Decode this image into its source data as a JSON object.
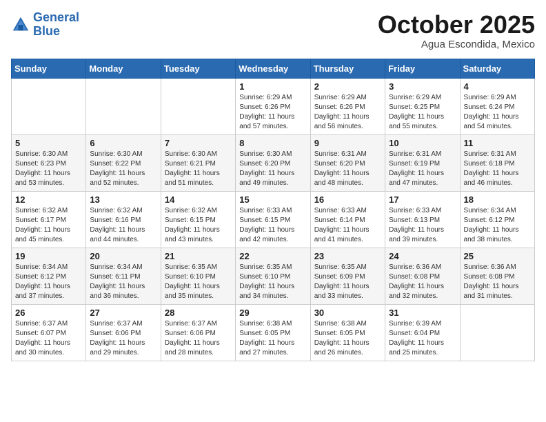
{
  "header": {
    "logo_line1": "General",
    "logo_line2": "Blue",
    "month": "October 2025",
    "location": "Agua Escondida, Mexico"
  },
  "weekdays": [
    "Sunday",
    "Monday",
    "Tuesday",
    "Wednesday",
    "Thursday",
    "Friday",
    "Saturday"
  ],
  "weeks": [
    [
      {
        "day": "",
        "info": ""
      },
      {
        "day": "",
        "info": ""
      },
      {
        "day": "",
        "info": ""
      },
      {
        "day": "1",
        "info": "Sunrise: 6:29 AM\nSunset: 6:26 PM\nDaylight: 11 hours and 57 minutes."
      },
      {
        "day": "2",
        "info": "Sunrise: 6:29 AM\nSunset: 6:26 PM\nDaylight: 11 hours and 56 minutes."
      },
      {
        "day": "3",
        "info": "Sunrise: 6:29 AM\nSunset: 6:25 PM\nDaylight: 11 hours and 55 minutes."
      },
      {
        "day": "4",
        "info": "Sunrise: 6:29 AM\nSunset: 6:24 PM\nDaylight: 11 hours and 54 minutes."
      }
    ],
    [
      {
        "day": "5",
        "info": "Sunrise: 6:30 AM\nSunset: 6:23 PM\nDaylight: 11 hours and 53 minutes."
      },
      {
        "day": "6",
        "info": "Sunrise: 6:30 AM\nSunset: 6:22 PM\nDaylight: 11 hours and 52 minutes."
      },
      {
        "day": "7",
        "info": "Sunrise: 6:30 AM\nSunset: 6:21 PM\nDaylight: 11 hours and 51 minutes."
      },
      {
        "day": "8",
        "info": "Sunrise: 6:30 AM\nSunset: 6:20 PM\nDaylight: 11 hours and 49 minutes."
      },
      {
        "day": "9",
        "info": "Sunrise: 6:31 AM\nSunset: 6:20 PM\nDaylight: 11 hours and 48 minutes."
      },
      {
        "day": "10",
        "info": "Sunrise: 6:31 AM\nSunset: 6:19 PM\nDaylight: 11 hours and 47 minutes."
      },
      {
        "day": "11",
        "info": "Sunrise: 6:31 AM\nSunset: 6:18 PM\nDaylight: 11 hours and 46 minutes."
      }
    ],
    [
      {
        "day": "12",
        "info": "Sunrise: 6:32 AM\nSunset: 6:17 PM\nDaylight: 11 hours and 45 minutes."
      },
      {
        "day": "13",
        "info": "Sunrise: 6:32 AM\nSunset: 6:16 PM\nDaylight: 11 hours and 44 minutes."
      },
      {
        "day": "14",
        "info": "Sunrise: 6:32 AM\nSunset: 6:15 PM\nDaylight: 11 hours and 43 minutes."
      },
      {
        "day": "15",
        "info": "Sunrise: 6:33 AM\nSunset: 6:15 PM\nDaylight: 11 hours and 42 minutes."
      },
      {
        "day": "16",
        "info": "Sunrise: 6:33 AM\nSunset: 6:14 PM\nDaylight: 11 hours and 41 minutes."
      },
      {
        "day": "17",
        "info": "Sunrise: 6:33 AM\nSunset: 6:13 PM\nDaylight: 11 hours and 39 minutes."
      },
      {
        "day": "18",
        "info": "Sunrise: 6:34 AM\nSunset: 6:12 PM\nDaylight: 11 hours and 38 minutes."
      }
    ],
    [
      {
        "day": "19",
        "info": "Sunrise: 6:34 AM\nSunset: 6:12 PM\nDaylight: 11 hours and 37 minutes."
      },
      {
        "day": "20",
        "info": "Sunrise: 6:34 AM\nSunset: 6:11 PM\nDaylight: 11 hours and 36 minutes."
      },
      {
        "day": "21",
        "info": "Sunrise: 6:35 AM\nSunset: 6:10 PM\nDaylight: 11 hours and 35 minutes."
      },
      {
        "day": "22",
        "info": "Sunrise: 6:35 AM\nSunset: 6:10 PM\nDaylight: 11 hours and 34 minutes."
      },
      {
        "day": "23",
        "info": "Sunrise: 6:35 AM\nSunset: 6:09 PM\nDaylight: 11 hours and 33 minutes."
      },
      {
        "day": "24",
        "info": "Sunrise: 6:36 AM\nSunset: 6:08 PM\nDaylight: 11 hours and 32 minutes."
      },
      {
        "day": "25",
        "info": "Sunrise: 6:36 AM\nSunset: 6:08 PM\nDaylight: 11 hours and 31 minutes."
      }
    ],
    [
      {
        "day": "26",
        "info": "Sunrise: 6:37 AM\nSunset: 6:07 PM\nDaylight: 11 hours and 30 minutes."
      },
      {
        "day": "27",
        "info": "Sunrise: 6:37 AM\nSunset: 6:06 PM\nDaylight: 11 hours and 29 minutes."
      },
      {
        "day": "28",
        "info": "Sunrise: 6:37 AM\nSunset: 6:06 PM\nDaylight: 11 hours and 28 minutes."
      },
      {
        "day": "29",
        "info": "Sunrise: 6:38 AM\nSunset: 6:05 PM\nDaylight: 11 hours and 27 minutes."
      },
      {
        "day": "30",
        "info": "Sunrise: 6:38 AM\nSunset: 6:05 PM\nDaylight: 11 hours and 26 minutes."
      },
      {
        "day": "31",
        "info": "Sunrise: 6:39 AM\nSunset: 6:04 PM\nDaylight: 11 hours and 25 minutes."
      },
      {
        "day": "",
        "info": ""
      }
    ]
  ]
}
